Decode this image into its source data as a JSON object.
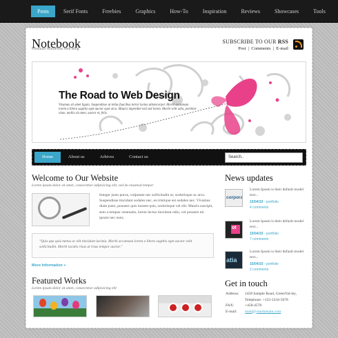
{
  "topnav": {
    "items": [
      "Posts",
      "Serif Fonts",
      "Freebies",
      "Graphics",
      "How-To",
      "Inspiration",
      "Reviews",
      "Showcases",
      "Tools"
    ],
    "active_index": 0
  },
  "header": {
    "logo": "Notebook",
    "tagline": "Premium WordPress Web Blog",
    "subscribe_prefix": "SUBSCRIBE TO OUR ",
    "subscribe_rss": "RSS",
    "links": [
      "Post",
      "Comments",
      "E-mail"
    ]
  },
  "banner": {
    "title": "The Road to Web Design",
    "text": "Vivamus sit amet ligula. Suspendisse ut tellus faucibus tortor luctus ullamcorper. Morbi accumsan lorem a libero sagittis eget auctor eget arcu. Mauris imperdiet nisl sed lorem. Morbi velit odio, porttitor vitae, mollis sit amet, auctor et, felis."
  },
  "mainnav": {
    "items": [
      "Home",
      "About us",
      "Arhives",
      "Contact us"
    ],
    "active_index": 0
  },
  "search": {
    "value": "Search.."
  },
  "welcome": {
    "title": "Welcome to Our Website",
    "subtitle": "Lorem ipsum dolor sit amet, consectetur adipisicing elit, sed do eiusmod tempor",
    "body": "Integer justo purus, vulputate nec sollicitudin ut, scelerisque ac arcu. Suspendisse tincidunt sodales nec, eu tristique est sodales nec. Vivamus diam justo, posuere quis laoreet quis, scelerisque vel elit. Mauris suscipit, sem a tempus venenatis, lorem lectus tincidunt odio, vel posuere mi ipsum nec nunc.",
    "quote": "\"Quis que quis metus ac elit tincidunt lacinia. Morbi accumsan lorem a libero sagittis eget auctor velit sollicitudin. Morbi iaculis risus at risus tempor auctor.\"",
    "more": "More Information »"
  },
  "featured": {
    "title": "Featured Works",
    "subtitle": "Lorem ipsum dolor sit amet, consectetur adipisicing elit"
  },
  "news": {
    "title": "News updates",
    "items": [
      {
        "text": "Lorem Ipsum is their default model text...",
        "date": "15/04/10",
        "sep": " - ",
        "category": "portfolio",
        "comments": "4 comments"
      },
      {
        "text": "Lorem Ipsum is their default model text...",
        "date": "15/04/10",
        "sep": " - ",
        "category": "portfolio",
        "comments": "7 comments"
      },
      {
        "text": "Lorem Ipsum is their default model text...",
        "date": "15/04/10",
        "sep": " - ",
        "category": "portfolio",
        "comments": "2 comments"
      }
    ],
    "thumb_labels": [
      "corporat",
      "ot",
      "atia"
    ]
  },
  "contact": {
    "title": "Get in touch",
    "address_label": "Address:",
    "address": "1458 Sample Road, GreenVal-ley, Telephone: +123-1234-5678",
    "fax_label": "FAX:",
    "fax": "+458-4578",
    "email_label": "E-mail:",
    "email": "mail@yourdomain.com"
  },
  "colors": {
    "accent": "#3aa6c9",
    "dark": "#111111",
    "pink": "#e8418a"
  }
}
